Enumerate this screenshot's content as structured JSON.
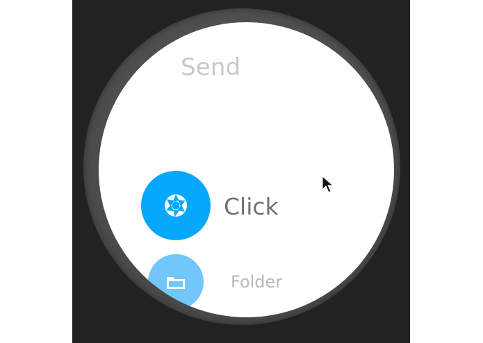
{
  "watch_screen": {
    "title": "Send",
    "actions": [
      {
        "label": "Click",
        "icon": "camera-shutter-icon"
      },
      {
        "label": "Folder",
        "icon": "folder-icon"
      }
    ]
  },
  "colors": {
    "background_outer": "#ffffff",
    "device_background": "#222222",
    "watch_bezel": "#555555",
    "screen": "#ffffff",
    "title_text": "#c8c8c8",
    "primary_action": "#07a8fb",
    "secondary_action": "#71c6fb",
    "primary_label": "#707070",
    "secondary_label": "#b8b8b8"
  },
  "cursor": {
    "icon": "mouse-pointer-icon"
  }
}
